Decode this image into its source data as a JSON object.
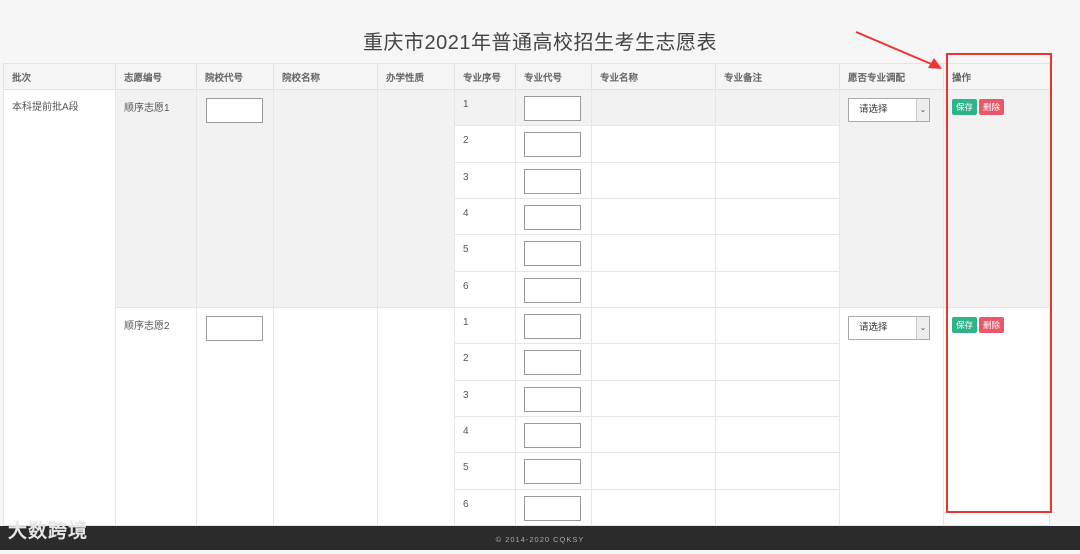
{
  "title": "重庆市2021年普通高校招生考生志愿表",
  "headers": [
    "批次",
    "志愿编号",
    "院校代号",
    "院校名称",
    "办学性质",
    "专业序号",
    "专业代号",
    "专业名称",
    "专业备注",
    "愿否专业调配",
    "操作"
  ],
  "batch": "本科提前批A段",
  "groups": [
    {
      "name": "顺序志愿1",
      "select": "请选择",
      "save": "保存",
      "delete": "删除",
      "majors": [
        "1",
        "2",
        "3",
        "4",
        "5",
        "6"
      ]
    },
    {
      "name": "顺序志愿2",
      "select": "请选择",
      "save": "保存",
      "delete": "删除",
      "majors": [
        "1",
        "2",
        "3",
        "4",
        "5",
        "6"
      ]
    }
  ],
  "footer": "© 2014-2020 CQKSY",
  "watermark": "大数跨境",
  "colors": {
    "save": "#2fb38a",
    "delete": "#e8586a",
    "highlight": "#e33333"
  }
}
